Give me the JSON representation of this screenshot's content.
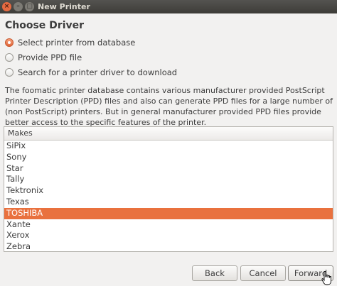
{
  "window": {
    "title": "New Printer",
    "controls": {
      "close": "×",
      "minimize": "–",
      "maximize": "□"
    }
  },
  "heading": "Choose Driver",
  "options": [
    {
      "label": "Select printer from database",
      "checked": true
    },
    {
      "label": "Provide PPD file",
      "checked": false
    },
    {
      "label": "Search for a printer driver to download",
      "checked": false
    }
  ],
  "description": "The foomatic printer database contains various manufacturer provided PostScript Printer Description (PPD) files and also can generate PPD files for a large number of (non PostScript) printers. But in general manufacturer provided PPD files provide better access to the specific features of the printer.",
  "makes_list": {
    "header": "Makes",
    "items": [
      "SiPix",
      "Sony",
      "Star",
      "Tally",
      "Tektronix",
      "Texas",
      "TOSHIBA",
      "Xante",
      "Xerox",
      "Zebra"
    ],
    "selected": "TOSHIBA"
  },
  "buttons": {
    "back": "Back",
    "cancel": "Cancel",
    "forward": "Forward"
  },
  "colors": {
    "accent": "#e9713e",
    "titlebar": "#3d3c38"
  }
}
